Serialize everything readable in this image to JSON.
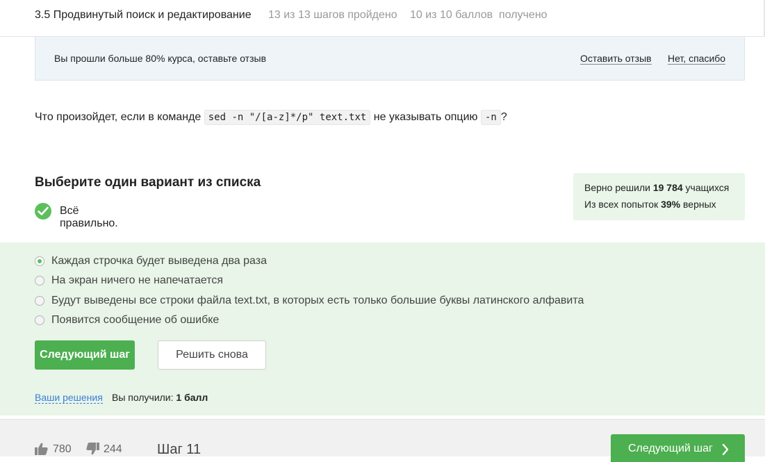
{
  "header": {
    "lesson_title": "3.5 Продвинутый поиск и редактирование",
    "steps_progress": "13 из 13 шагов пройдено",
    "score_progress": "10 из 10 баллов  получено"
  },
  "banner": {
    "text": "Вы прошли больше 80% курса, оставьте отзыв",
    "leave_review": "Оставить отзыв",
    "no_thanks": "Нет, спасибо"
  },
  "question": {
    "prefix": "Что произойдет, если в команде ",
    "command": "sed -n \"/[a-z]*/p\" text.txt",
    "middle": " не указывать опцию ",
    "option_code": "-n",
    "suffix": "?"
  },
  "task": {
    "title": "Выберите один вариант из списка",
    "status": "Всё правильно."
  },
  "stats": {
    "line1_prefix": "Верно решили ",
    "solvers": "19 784",
    "line1_suffix": " учащихся",
    "line2_prefix": "Из всех попыток ",
    "percent": "39%",
    "line2_suffix": " верных"
  },
  "options": [
    {
      "label": "Каждая строчка будет выведена два раза",
      "selected": true
    },
    {
      "label": "На экран ничего не напечатается",
      "selected": false
    },
    {
      "label": "Будут выведены все строки файла text.txt, в которых есть только большие буквы латинского алфавита",
      "selected": false
    },
    {
      "label": "Появится сообщение об ошибке",
      "selected": false
    }
  ],
  "actions": {
    "next_step": "Следующий шаг",
    "retry": "Решить снова",
    "your_solutions": "Ваши решения",
    "received_prefix": "Вы получили: ",
    "received_value": "1 балл"
  },
  "footer": {
    "likes": "780",
    "dislikes": "244",
    "step": "Шаг 11",
    "next_step": "Следующий шаг"
  },
  "colors": {
    "accent_green": "#4caf50",
    "answers_background": "#e8f5e8",
    "link_blue": "#3b7dd8"
  },
  "icons": [
    "check-circle-icon",
    "radio-icon",
    "thumbs-up-icon",
    "thumbs-down-icon",
    "chevron-right-icon"
  ]
}
